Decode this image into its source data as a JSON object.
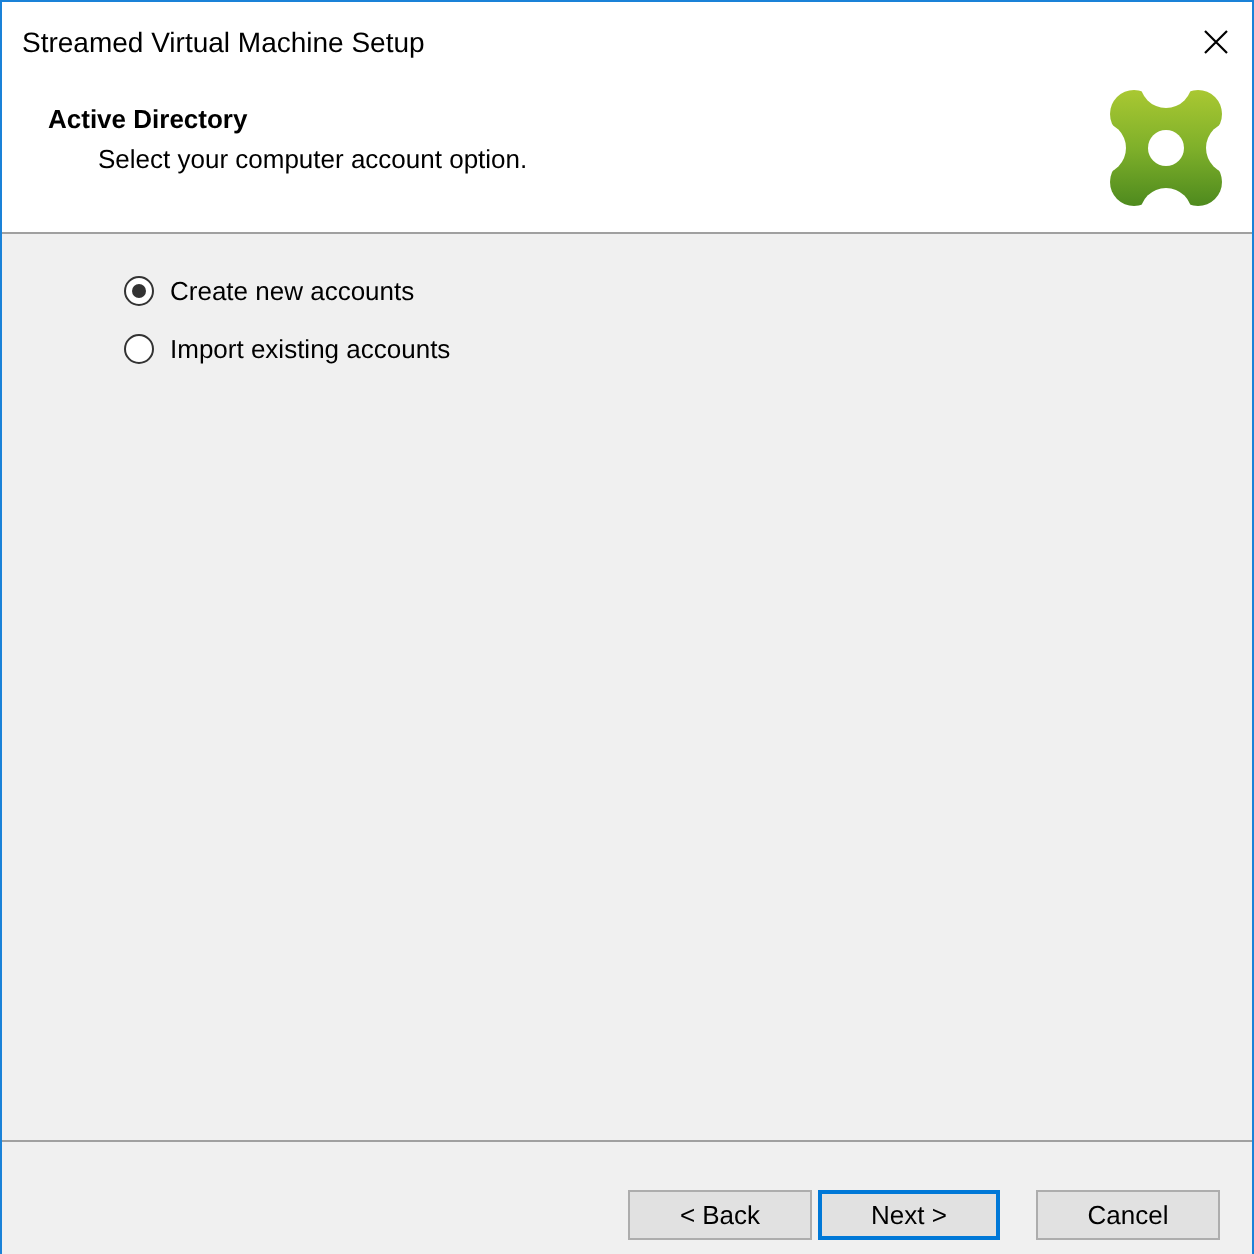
{
  "window": {
    "title": "Streamed Virtual Machine Setup"
  },
  "header": {
    "title": "Active Directory",
    "subtitle": "Select your computer account option."
  },
  "options": [
    {
      "label": "Create new accounts",
      "selected": true
    },
    {
      "label": "Import existing accounts",
      "selected": false
    }
  ],
  "buttons": [
    {
      "label": "< Back",
      "kind": "nav",
      "default": false
    },
    {
      "label": "Next >",
      "kind": "nav",
      "default": true
    },
    {
      "label": "Cancel",
      "kind": "cancel",
      "default": false
    }
  ]
}
